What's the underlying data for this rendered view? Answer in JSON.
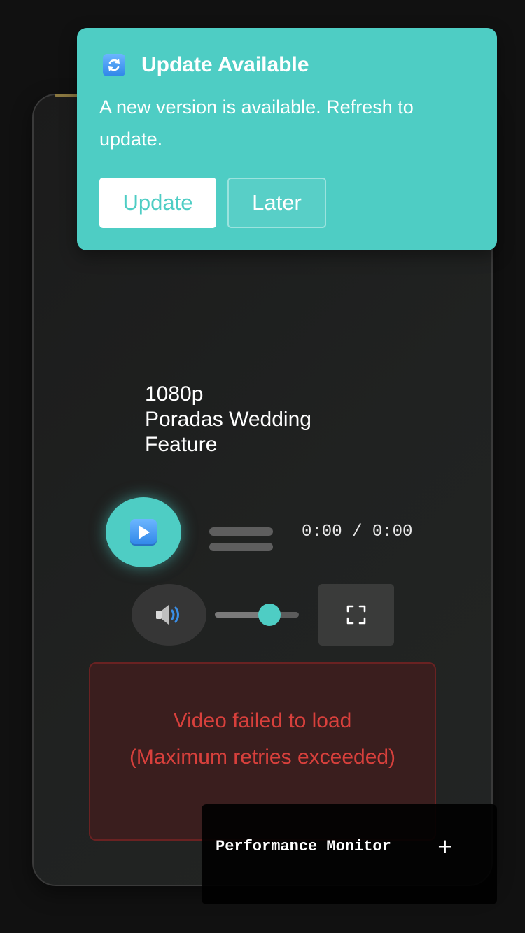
{
  "player": {
    "quality": "1080p",
    "title_line1": "Poradas Wedding",
    "title_line2": "Feature",
    "time_display": "0:00 / 0:00",
    "volume_level": 0.65,
    "icons": {
      "play": "play-icon",
      "volume": "speaker-icon",
      "fullscreen": "fullscreen-icon"
    }
  },
  "error": {
    "title": "Video failed to load",
    "detail": "(Maximum retries exceeded)"
  },
  "performance_monitor": {
    "title": "Performance Monitor",
    "toggle": "+"
  },
  "update_toast": {
    "icon": "refresh-icon",
    "title": "Update Available",
    "message": "A new version is available. Refresh to update.",
    "update_label": "Update",
    "later_label": "Later"
  },
  "colors": {
    "accent": "#4ecdc4",
    "error_text": "#d8403c",
    "background": "#111111"
  }
}
